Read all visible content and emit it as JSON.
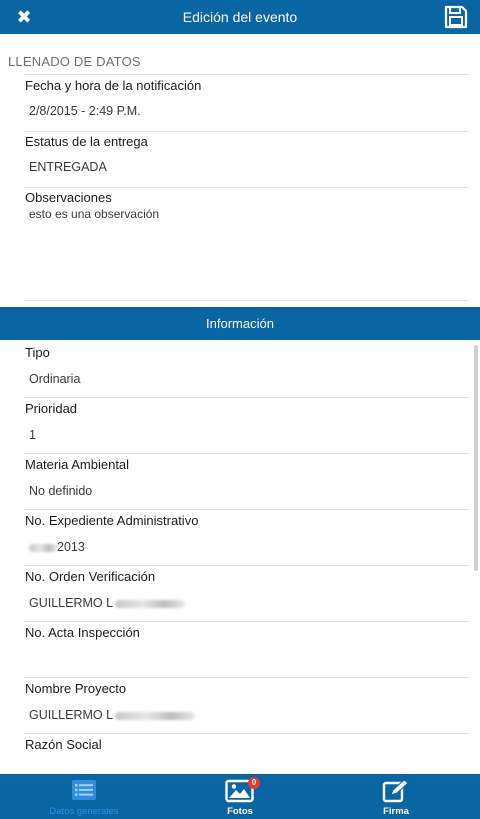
{
  "header": {
    "title": "Edición del evento",
    "close_icon": "close-icon",
    "save_icon": "save-icon"
  },
  "section": {
    "label": "LLENADO DE DATOS"
  },
  "fields": {
    "fecha_label": "Fecha y hora de la notificación",
    "fecha_value": "2/8/2015 - 2:49  P.M.",
    "estatus_label": "Estatus de la entrega",
    "estatus_value": "ENTREGADA",
    "observaciones_label": "Observaciones",
    "observaciones_value": "esto es una observación"
  },
  "info": {
    "title": "Información",
    "items": [
      {
        "label": "Tipo",
        "value": "Ordinaria"
      },
      {
        "label": "Prioridad",
        "value": "1"
      },
      {
        "label": "Materia Ambiental",
        "value": "No definido"
      },
      {
        "label": "No. Expediente Administrativo",
        "value": "2013"
      },
      {
        "label": "No. Orden Verificación",
        "value": "GUILLERMO L"
      },
      {
        "label": "No. Acta Inspección",
        "value": ""
      },
      {
        "label": "Nombre Proyecto",
        "value": "GUILLERMO L"
      },
      {
        "label": "Razón Social",
        "value": ""
      }
    ]
  },
  "tabs": [
    {
      "label": "Datos generales",
      "icon": "list-icon",
      "active": true
    },
    {
      "label": "Fotos",
      "icon": "photo-icon",
      "badge": "0",
      "active": false
    },
    {
      "label": "Firma",
      "icon": "edit-icon",
      "active": false
    }
  ],
  "colors": {
    "primary": "#0a66a3",
    "active_tab": "#2f8fdc",
    "badge": "#e53935"
  }
}
